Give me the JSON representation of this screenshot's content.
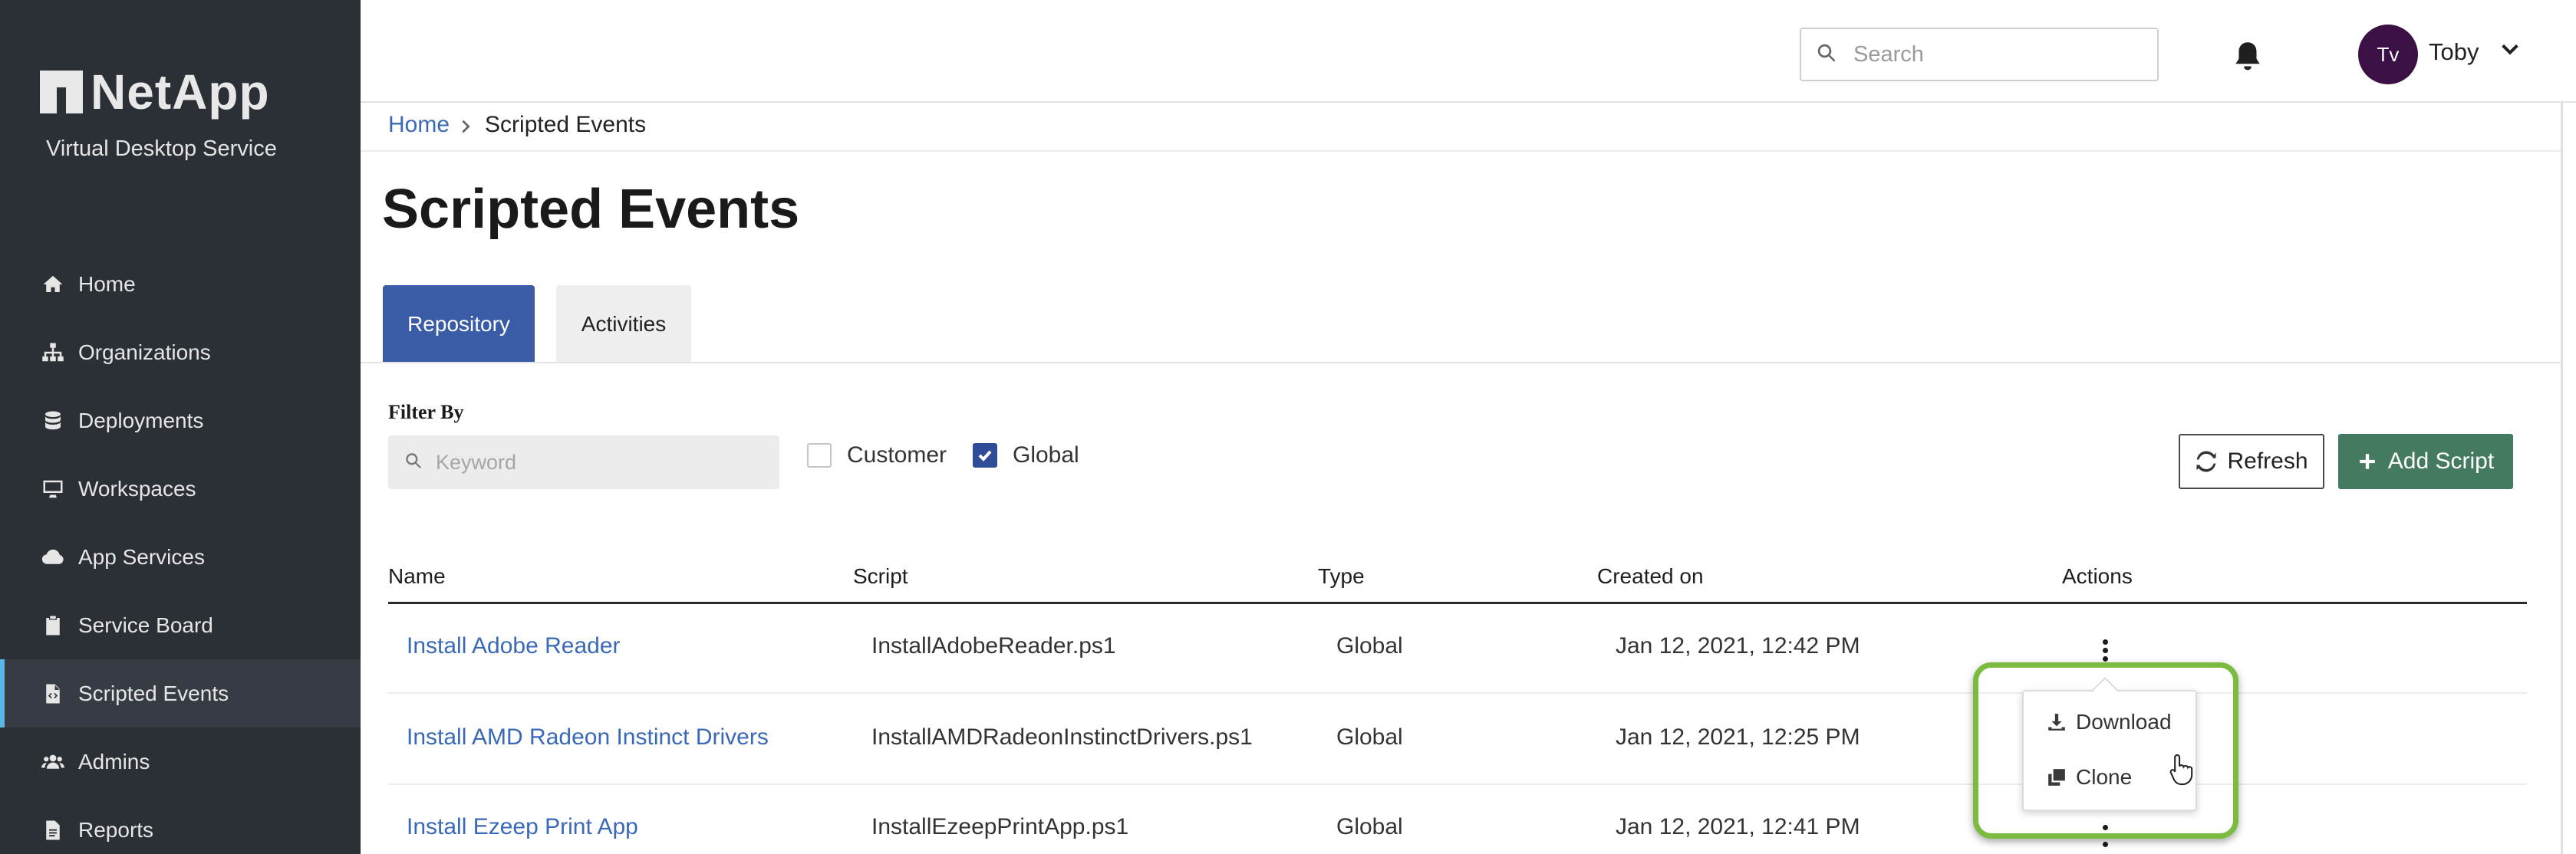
{
  "brand": {
    "name": "NetApp",
    "subtitle": "Virtual Desktop Service"
  },
  "sidebar": {
    "items": [
      {
        "label": "Home",
        "icon": "home-icon",
        "active": false
      },
      {
        "label": "Organizations",
        "icon": "sitemap-icon",
        "active": false
      },
      {
        "label": "Deployments",
        "icon": "database-icon",
        "active": false
      },
      {
        "label": "Workspaces",
        "icon": "desktop-icon",
        "active": false
      },
      {
        "label": "App Services",
        "icon": "cloud-icon",
        "active": false
      },
      {
        "label": "Service Board",
        "icon": "clipboard-icon",
        "active": false
      },
      {
        "label": "Scripted Events",
        "icon": "file-code-icon",
        "active": true
      },
      {
        "label": "Admins",
        "icon": "users-icon",
        "active": false
      },
      {
        "label": "Reports",
        "icon": "file-text-icon",
        "active": false
      }
    ]
  },
  "topbar": {
    "search_placeholder": "Search",
    "user": {
      "initials": "Tv",
      "name": "Toby"
    }
  },
  "breadcrumb": {
    "home": "Home",
    "current": "Scripted Events"
  },
  "page": {
    "title": "Scripted Events"
  },
  "tabs": [
    {
      "label": "Repository",
      "active": true
    },
    {
      "label": "Activities",
      "active": false
    }
  ],
  "filter": {
    "label": "Filter By",
    "keyword_placeholder": "Keyword",
    "options": [
      {
        "label": "Customer",
        "checked": false
      },
      {
        "label": "Global",
        "checked": true
      }
    ]
  },
  "toolbar": {
    "refresh_label": "Refresh",
    "add_label": "Add Script"
  },
  "table": {
    "columns": [
      "Name",
      "Script",
      "Type",
      "Created on",
      "Actions"
    ],
    "rows": [
      {
        "name": "Install Adobe Reader",
        "script": "InstallAdobeReader.ps1",
        "type": "Global",
        "created": "Jan 12, 2021, 12:42 PM"
      },
      {
        "name": "Install AMD Radeon Instinct Drivers",
        "script": "InstallAMDRadeonInstinctDrivers.ps1",
        "type": "Global",
        "created": "Jan 12, 2021, 12:25 PM"
      },
      {
        "name": "Install Ezeep Print App",
        "script": "InstallEzeepPrintApp.ps1",
        "type": "Global",
        "created": "Jan 12, 2021, 12:41 PM"
      }
    ]
  },
  "actions_menu": {
    "download_label": "Download",
    "clone_label": "Clone"
  },
  "colors": {
    "sidebar_bg": "#2b2f36",
    "active_accent": "#58b6e3",
    "tab_active": "#3a5ca6",
    "link": "#3a69b7",
    "add_button": "#447a5f",
    "highlight": "#7bbb3f"
  }
}
